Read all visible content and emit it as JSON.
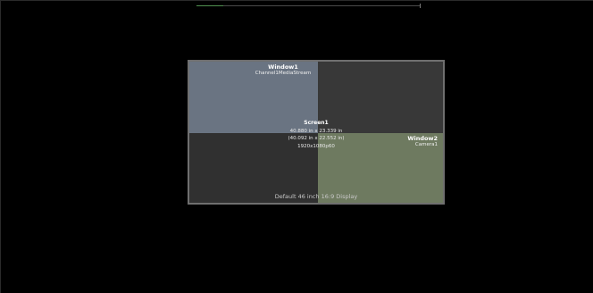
{
  "toolbar": {
    "progress_fraction": 0.12
  },
  "display": {
    "label": "Default 46 inch 16:9 Display",
    "screen": {
      "name": "Screen1",
      "size": "40.880 in x 23.339 in",
      "size_alt": "(40.092 in x 22.552 in)",
      "resolution": "1920x1080p60"
    },
    "windows": [
      {
        "title": "Window1",
        "source": "Channel1MediaStream",
        "color": "#6a7482"
      },
      {
        "title": "Window2",
        "source": "Camera1",
        "color": "#6e7a60"
      }
    ]
  },
  "colors": {
    "background": "#000000",
    "display_border": "#6f6f6f",
    "progress_fill": "#4f8f4f"
  }
}
